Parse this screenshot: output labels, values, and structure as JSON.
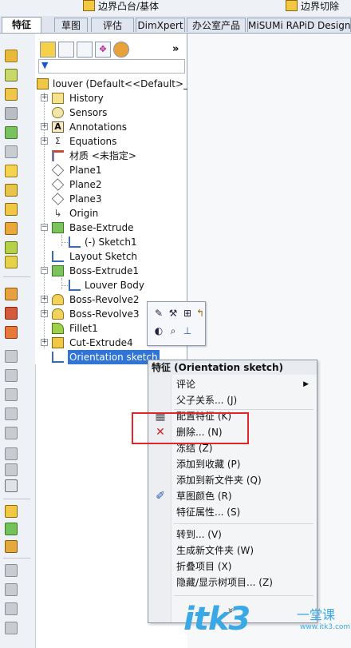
{
  "ribbon": {
    "left_label": "边界凸台/基体",
    "right_label": "边界切除"
  },
  "tabs": [
    {
      "label": "特征"
    },
    {
      "label": "草图"
    },
    {
      "label": "评估"
    },
    {
      "label": "DimXpert"
    },
    {
      "label": "办公室产品"
    },
    {
      "label": "MiSUMi RAPiD Design"
    }
  ],
  "feature_tree": {
    "root": "louver  (Default<<Default>_",
    "items": [
      {
        "label": "History"
      },
      {
        "label": "Sensors"
      },
      {
        "label": "Annotations"
      },
      {
        "label": "Equations"
      },
      {
        "label": "材质 <未指定>"
      },
      {
        "label": "Plane1"
      },
      {
        "label": "Plane2"
      },
      {
        "label": "Plane3"
      },
      {
        "label": "Origin"
      },
      {
        "label": "Base-Extrude"
      },
      {
        "label": "(-) Sketch1"
      },
      {
        "label": "Layout Sketch"
      },
      {
        "label": "Boss-Extrude1"
      },
      {
        "label": "Louver Body"
      },
      {
        "label": "Boss-Revolve2"
      },
      {
        "label": "Boss-Revolve3"
      },
      {
        "label": "Fillet1"
      },
      {
        "label": "Cut-Extrude4"
      },
      {
        "label": "Orientation sketch"
      }
    ]
  },
  "context_menu": {
    "header": "特征 (Orientation sketch)",
    "items": [
      {
        "label": "评论"
      },
      {
        "label": "父子关系... (J)"
      },
      {
        "label": "配置特征 (K)"
      },
      {
        "label": "删除... (N)"
      },
      {
        "label": "冻结 (Z)"
      },
      {
        "label": "添加到收藏 (P)"
      },
      {
        "label": "添加到新文件夹 (Q)"
      },
      {
        "label": "草图颜色 (R)"
      },
      {
        "label": "特征属性... (S)"
      },
      {
        "label": "转到... (V)"
      },
      {
        "label": "生成新文件夹 (W)"
      },
      {
        "label": "折叠项目 (X)"
      },
      {
        "label": "隐藏/显示树项目... (Z)"
      }
    ],
    "more": "»"
  },
  "icons": {
    "filter": "filter-icon",
    "delete": "delete-x-icon",
    "submenu": "submenu-arrow-icon"
  },
  "colors": {
    "selection": "#2f74d6",
    "highlight_box": "#e0262c",
    "watermark": "#3aa8e4"
  },
  "watermark": {
    "text": "itk3",
    "cn": "一堂课",
    "url": "www.itk3.com"
  }
}
